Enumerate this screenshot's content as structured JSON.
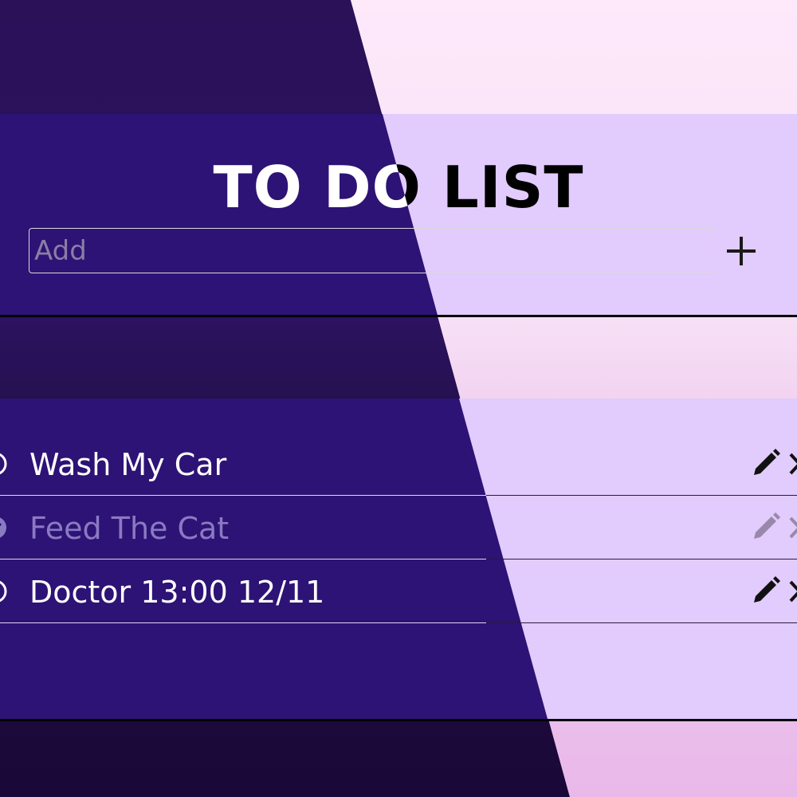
{
  "app": {
    "title": "TO DO LIST"
  },
  "add": {
    "placeholder": "Add",
    "value": "",
    "button_icon": "plus-icon"
  },
  "todos": [
    {
      "label": "Wash My Car",
      "done": false
    },
    {
      "label": "Feed The Cat",
      "done": true
    },
    {
      "label": "Doctor 13:00 12/11",
      "done": false
    }
  ],
  "colors": {
    "panel_dark": "#2d1375",
    "panel_light": "#e2cbfd",
    "done_text": "#8a7ac2"
  },
  "icons": {
    "check": "check-circle-icon",
    "edit": "pencil-icon",
    "delete": "close-icon"
  }
}
